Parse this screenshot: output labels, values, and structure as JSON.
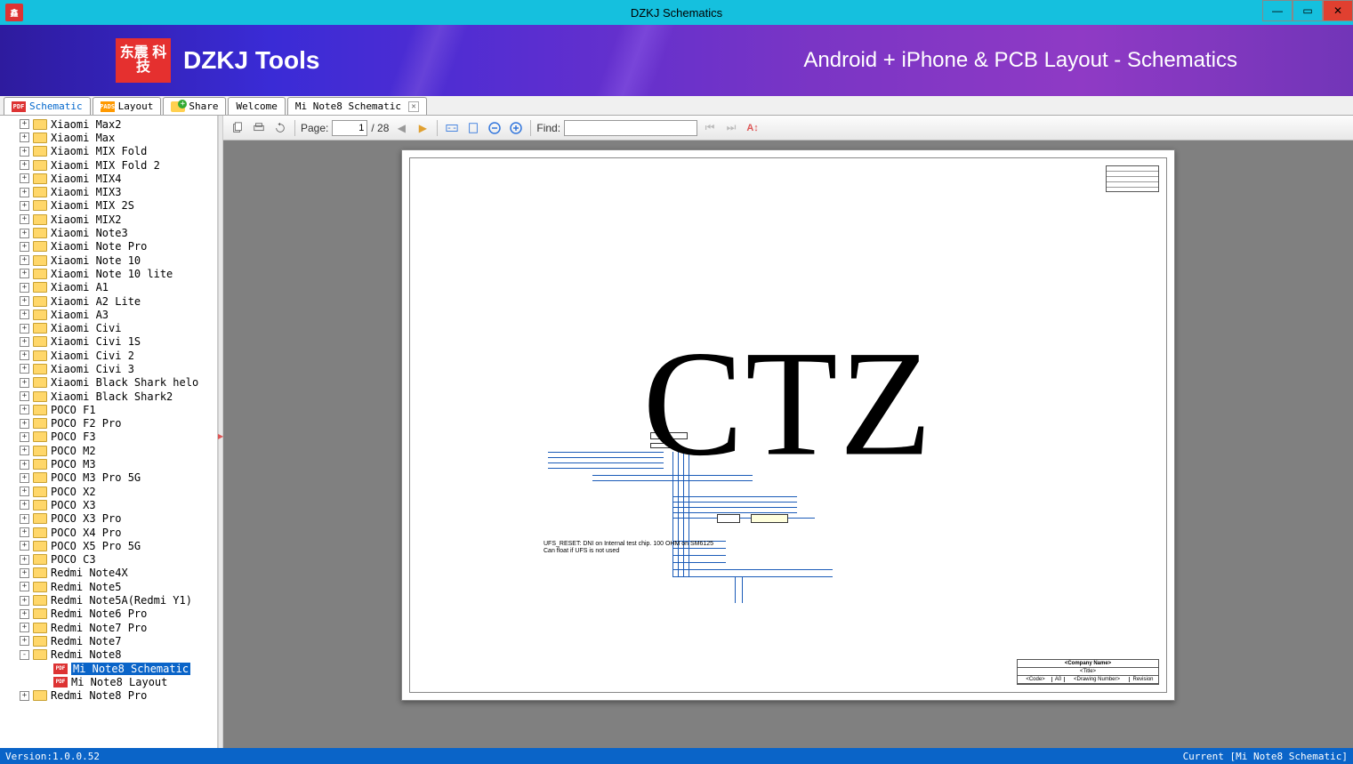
{
  "window": {
    "title": "DZKJ Schematics"
  },
  "banner": {
    "logo_cn": "东震\n科技",
    "logo_text": "DZKJ Tools",
    "tagline": "Android + iPhone & PCB Layout - Schematics"
  },
  "tabs": {
    "schematic": "Schematic",
    "layout": "Layout",
    "share": "Share",
    "welcome": "Welcome",
    "current": "Mi Note8 Schematic"
  },
  "tree": [
    {
      "label": "Xiaomi Max2",
      "type": "folder",
      "exp": "+"
    },
    {
      "label": "Xiaomi Max",
      "type": "folder",
      "exp": "+"
    },
    {
      "label": "Xiaomi MIX Fold",
      "type": "folder",
      "exp": "+"
    },
    {
      "label": "Xiaomi MIX Fold 2",
      "type": "folder",
      "exp": "+"
    },
    {
      "label": "Xiaomi MIX4",
      "type": "folder",
      "exp": "+"
    },
    {
      "label": "Xiaomi MIX3",
      "type": "folder",
      "exp": "+"
    },
    {
      "label": "Xiaomi MIX 2S",
      "type": "folder",
      "exp": "+"
    },
    {
      "label": "Xiaomi MIX2",
      "type": "folder",
      "exp": "+"
    },
    {
      "label": "Xiaomi Note3",
      "type": "folder",
      "exp": "+"
    },
    {
      "label": "Xiaomi Note Pro",
      "type": "folder",
      "exp": "+"
    },
    {
      "label": "Xiaomi Note 10",
      "type": "folder",
      "exp": "+"
    },
    {
      "label": "Xiaomi Note 10 lite",
      "type": "folder",
      "exp": "+"
    },
    {
      "label": "Xiaomi A1",
      "type": "folder",
      "exp": "+"
    },
    {
      "label": "Xiaomi A2 Lite",
      "type": "folder",
      "exp": "+"
    },
    {
      "label": "Xiaomi A3",
      "type": "folder",
      "exp": "+"
    },
    {
      "label": "Xiaomi Civi",
      "type": "folder",
      "exp": "+"
    },
    {
      "label": "Xiaomi Civi 1S",
      "type": "folder",
      "exp": "+"
    },
    {
      "label": "Xiaomi Civi 2",
      "type": "folder",
      "exp": "+"
    },
    {
      "label": "Xiaomi Civi 3",
      "type": "folder",
      "exp": "+"
    },
    {
      "label": "Xiaomi Black Shark helo",
      "type": "folder",
      "exp": "+"
    },
    {
      "label": "Xiaomi Black Shark2",
      "type": "folder",
      "exp": "+"
    },
    {
      "label": "POCO F1",
      "type": "folder",
      "exp": "+"
    },
    {
      "label": "POCO F2 Pro",
      "type": "folder",
      "exp": "+"
    },
    {
      "label": "POCO F3",
      "type": "folder",
      "exp": "+"
    },
    {
      "label": "POCO M2",
      "type": "folder",
      "exp": "+"
    },
    {
      "label": "POCO M3",
      "type": "folder",
      "exp": "+"
    },
    {
      "label": "POCO M3 Pro 5G",
      "type": "folder",
      "exp": "+"
    },
    {
      "label": "POCO X2",
      "type": "folder",
      "exp": "+"
    },
    {
      "label": "POCO X3",
      "type": "folder",
      "exp": "+"
    },
    {
      "label": "POCO X3 Pro",
      "type": "folder",
      "exp": "+"
    },
    {
      "label": "POCO X4 Pro",
      "type": "folder",
      "exp": "+"
    },
    {
      "label": "POCO X5 Pro 5G",
      "type": "folder",
      "exp": "+"
    },
    {
      "label": "POCO C3",
      "type": "folder",
      "exp": "+"
    },
    {
      "label": "Redmi Note4X",
      "type": "folder",
      "exp": "+"
    },
    {
      "label": "Redmi Note5",
      "type": "folder",
      "exp": "+"
    },
    {
      "label": "Redmi Note5A(Redmi Y1)",
      "type": "folder",
      "exp": "+"
    },
    {
      "label": "Redmi Note6 Pro",
      "type": "folder",
      "exp": "+"
    },
    {
      "label": "Redmi Note7 Pro",
      "type": "folder",
      "exp": "+"
    },
    {
      "label": "Redmi Note7",
      "type": "folder",
      "exp": "+"
    },
    {
      "label": "Redmi Note8",
      "type": "folder",
      "exp": "-",
      "children": [
        {
          "label": "Mi Note8 Schematic",
          "type": "pdf",
          "selected": true
        },
        {
          "label": "Mi Note8 Layout",
          "type": "pdf"
        }
      ]
    },
    {
      "label": "Redmi Note8 Pro",
      "type": "folder",
      "exp": "+"
    }
  ],
  "toolbar": {
    "page_label": "Page:",
    "page_current": "1",
    "page_total": "/ 28",
    "find_label": "Find:"
  },
  "document": {
    "watermark": "CTZ",
    "note_line1": "UFS_RESET: DNI on Internal test chip. 100 OHM on SM6125",
    "note_line2": "Can float if UFS is not used",
    "titleblock": {
      "company": "<Company Name>",
      "title": "<Title>",
      "code": "<Code>",
      "size": "A0",
      "number": "<Drawing Number>",
      "rev": "Revision"
    }
  },
  "status": {
    "version": "Version:1.0.0.52",
    "current": "Current [Mi Note8 Schematic]"
  }
}
